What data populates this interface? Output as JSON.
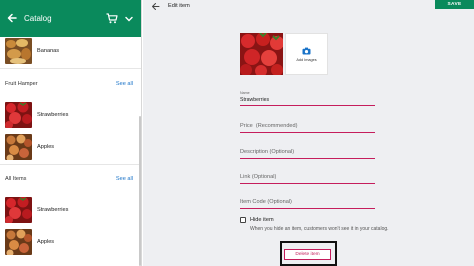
{
  "left_panel": {
    "appbar": {
      "title": "Catalog",
      "color": "#0a8a5c"
    },
    "items_top": [
      {
        "label": "Bananas"
      }
    ],
    "sections": [
      {
        "title": "Fruit Hamper",
        "see_all": "See all",
        "items": [
          {
            "label": "Strawberries"
          },
          {
            "label": "Apples"
          }
        ]
      },
      {
        "title": "All Items",
        "see_all": "See all",
        "items": [
          {
            "label": "Strawberries"
          },
          {
            "label": "Apples"
          }
        ]
      }
    ]
  },
  "right_panel": {
    "topbar": {
      "title": "Edit item",
      "save_label": "SAVE"
    },
    "images": {
      "add_label": "Add Images"
    },
    "fields": {
      "name": {
        "label": "Name",
        "value": "Strawberries"
      },
      "price": {
        "placeholder": "Price  (Recommended)"
      },
      "description": {
        "placeholder": "Description (Optional)"
      },
      "link": {
        "placeholder": "Link (Optional)"
      },
      "item_code": {
        "placeholder": "Item Code (Optional)"
      }
    },
    "hide_item": {
      "label": "Hide item",
      "checked": false,
      "help": "When you hide an item, customers won't see it in your catalog."
    },
    "delete_label": "Delete item",
    "accent_color": "#c51d5c"
  }
}
